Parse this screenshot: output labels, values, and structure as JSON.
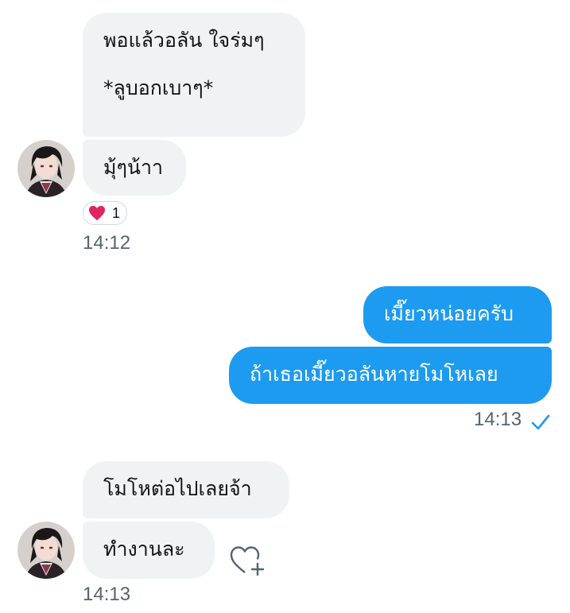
{
  "conversation": {
    "messages": [
      {
        "sender": "other",
        "text": "พอแล้วอลัน ใจร่มๆ\n\n*ลูบอกเบาๆ*"
      },
      {
        "sender": "other",
        "text": "มุ้ๆน้าา",
        "reaction": {
          "emoji": "heart",
          "count": "1"
        }
      },
      {
        "sender": "me",
        "text": "เมี๊ยวหน่อยครับ"
      },
      {
        "sender": "me",
        "text": "ถ้าเธอเมี๊ยวอลันหายโมโหเลย"
      },
      {
        "sender": "other",
        "text": "โมโหต่อไปเลยจ้า"
      },
      {
        "sender": "other",
        "text": "ทำงานละ"
      }
    ],
    "timestamps": [
      "14:12",
      "14:13",
      "14:13"
    ]
  },
  "colors": {
    "incoming_bubble": "#eff3f4",
    "outgoing_bubble": "#1d9bf0",
    "timestamp_text": "#536471",
    "read_check": "#1d9bf0",
    "heart": "#e0245e"
  },
  "icons": {
    "read_receipt": "check-icon",
    "react": "add-reaction-heart-icon",
    "reaction": "heart-icon"
  }
}
